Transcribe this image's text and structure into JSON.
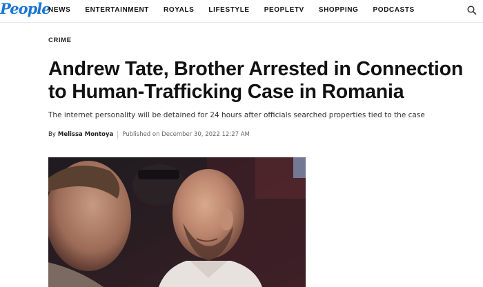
{
  "logo": "People",
  "nav": [
    "NEWS",
    "ENTERTAINMENT",
    "ROYALS",
    "LIFESTYLE",
    "PEOPLETV",
    "SHOPPING",
    "PODCASTS"
  ],
  "icons": {
    "search": "search-icon"
  },
  "article": {
    "kicker": "CRIME",
    "headline": "Andrew Tate, Brother Arrested in Connection to Human-Trafficking Case in Romania",
    "dek": "The internet personality will be detained for 24 hours after officials searched properties tied to the case",
    "by": "By",
    "author": "Melissa Montoya",
    "published": "Published on December 30, 2022 12:27 AM"
  },
  "colors": {
    "brand": "#1b76d3"
  }
}
